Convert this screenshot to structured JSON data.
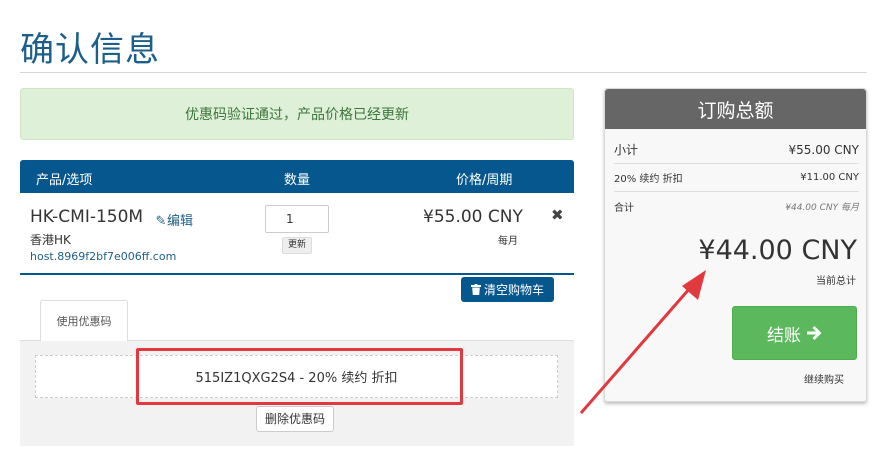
{
  "page": {
    "title": "确认信息"
  },
  "alert": {
    "message": "优惠码验证通过，产品价格已经更新"
  },
  "cart": {
    "columns": {
      "product": "产品/选项",
      "quantity": "数量",
      "price": "价格/周期"
    },
    "item": {
      "name": "HK-CMI-150M",
      "edit_label": "编辑",
      "group": "香港HK",
      "domain": "host.8969f2bf7e006ff.com",
      "quantity": "1",
      "update_label": "更新",
      "price": "¥55.00 CNY",
      "cycle": "每月",
      "remove_symbol": "✖"
    },
    "empty_cart_label": "清空购物车"
  },
  "promo": {
    "tab_label": "使用优惠码",
    "applied_text": "515IZ1QXG2S4 - 20% 续约 折扣",
    "remove_label": "删除优惠码"
  },
  "summary": {
    "header": "订购总额",
    "rows": [
      {
        "label": "小计",
        "value": "¥55.00 CNY"
      },
      {
        "label": "20% 续约 折扣",
        "value": "¥11.00 CNY"
      },
      {
        "label": "合计",
        "value": "¥44.00 CNY 每月"
      }
    ],
    "total_amount": "¥44.00 CNY",
    "total_label": "当前总计",
    "checkout_label": "结账",
    "continue_label": "继续购买"
  },
  "icons": {
    "edit": "pencil-icon",
    "trash": "trash-icon",
    "checkout_arrow": "arrow-right-icon"
  },
  "colors": {
    "primary": "#06578e",
    "title": "#1d5f8b",
    "success_bg": "#dff0d8",
    "success_text": "#3c763d",
    "checkout": "#5cb85c",
    "summary_header": "#666666",
    "annotation": "#e0393e"
  }
}
